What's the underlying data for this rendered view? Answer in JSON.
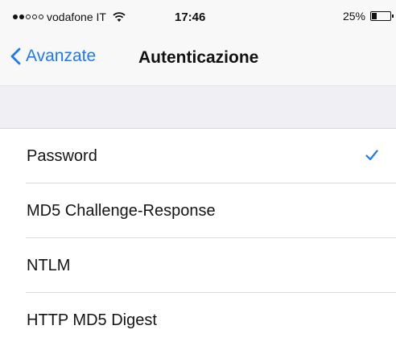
{
  "status_bar": {
    "signal_filled": 2,
    "signal_total": 5,
    "carrier": "vodafone IT",
    "time": "17:46",
    "battery_text": "25%",
    "battery_level": 0.25
  },
  "nav": {
    "back_label": "Avanzate",
    "title": "Autenticazione"
  },
  "options": [
    {
      "label": "Password",
      "selected": true
    },
    {
      "label": "MD5 Challenge-Response",
      "selected": false
    },
    {
      "label": "NTLM",
      "selected": false
    },
    {
      "label": "HTTP MD5 Digest",
      "selected": false
    }
  ],
  "colors": {
    "accent": "#1e7af2",
    "bar_background": "#f8f8f8",
    "group_background": "#efeff4",
    "separator": "#dcdce0"
  },
  "icons": {
    "back": "chevron-left-icon",
    "wifi": "wifi-icon",
    "battery": "battery-icon",
    "selected": "checkmark-icon"
  }
}
